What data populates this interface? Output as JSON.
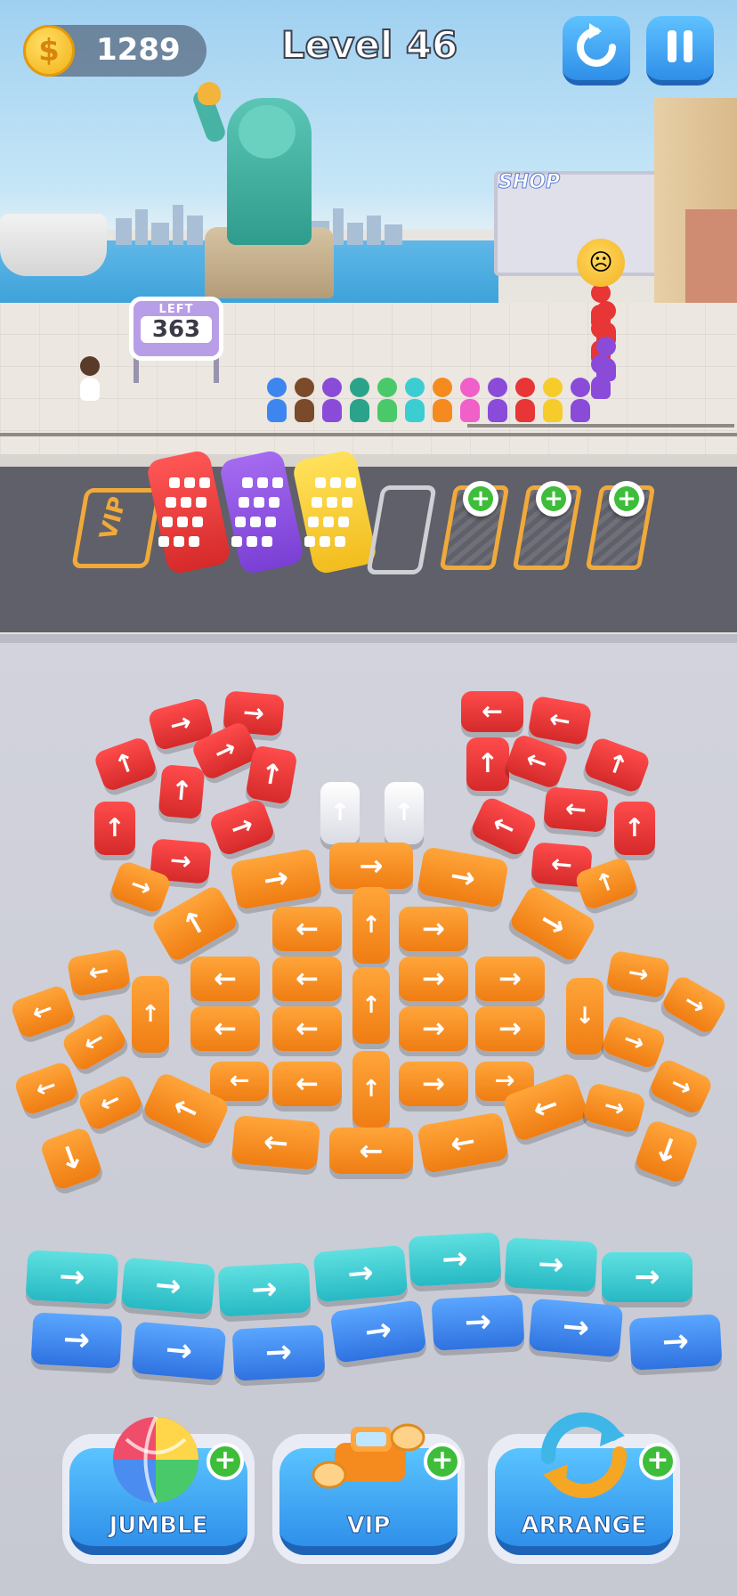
{
  "hud": {
    "coin_icon": "coin-icon",
    "coin_symbol": "$",
    "coins": "1289",
    "level": "Level 46",
    "restart_icon": "restart-icon",
    "pause_icon": "pause-icon"
  },
  "scene": {
    "left_label": "LEFT",
    "left_count": "363",
    "shop_label": "SHOP",
    "vip_slot_label": "VIP",
    "waiting_mood_icon": "sad-face-icon"
  },
  "boosters": [
    {
      "label": "JUMBLE",
      "icon": "color-ball-icon",
      "add": "+"
    },
    {
      "label": "VIP",
      "icon": "flying-car-icon",
      "add": "+"
    },
    {
      "label": "ARRANGE",
      "icon": "swap-arrows-icon",
      "add": "+"
    }
  ],
  "colors": {
    "red": "#e83535",
    "orange": "#f58a1f",
    "cyan": "#3ccdd3",
    "blue": "#3d86f0",
    "purple": "#8a4bd9",
    "yellow": "#f6cc2a",
    "button_blue": "#3b9ff0",
    "plus_green": "#3dbd3a"
  }
}
